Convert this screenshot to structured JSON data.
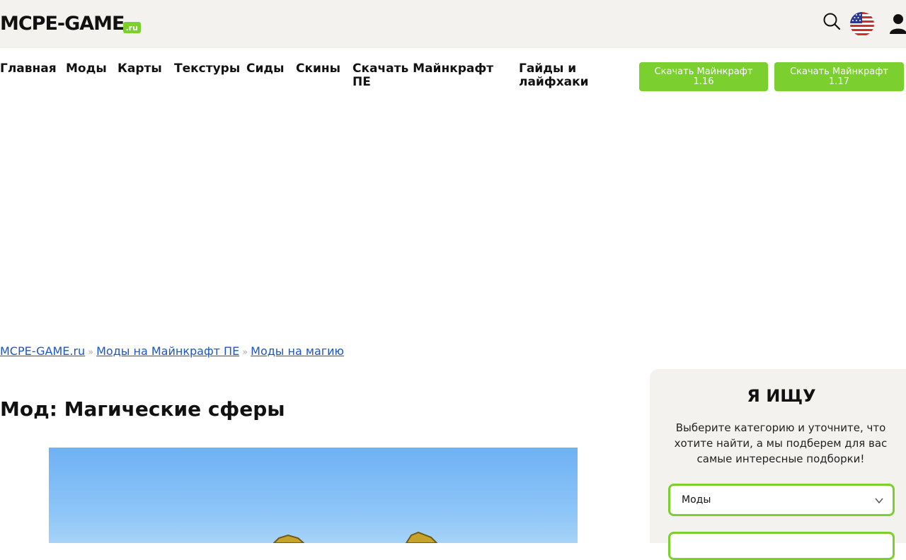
{
  "header": {
    "logo_text": "MCPE-GAME",
    "logo_suffix": ".ru",
    "icons": [
      "search-icon",
      "us-flag-icon",
      "user-icon"
    ]
  },
  "nav": {
    "items": [
      "Главная",
      "Моды",
      "Карты",
      "Текстуры",
      "Сиды",
      "Скины",
      "Скачать Майнкрафт ПЕ",
      "Гайды и лайфхаки"
    ],
    "buttons": [
      {
        "line1": "Скачать Майнкрафт",
        "line2": "1.16"
      },
      {
        "line1": "Скачать Майнкрафт",
        "line2": "1.17"
      }
    ]
  },
  "breadcrumb": {
    "items": [
      "MCPE-GAME.ru",
      "Моды на Майнкрафт ПЕ",
      "Моды на магию"
    ],
    "separator": "»"
  },
  "article": {
    "title": "Мод: Магические сферы"
  },
  "sidebar": {
    "title": "Я ИЩУ",
    "text": "Выберите категорию и уточните, что хотите найти, а мы подберем для вас самые интересные подборки!",
    "select_value": "Моды"
  },
  "colors": {
    "accent": "#7bcf2e",
    "header_bg": "#f3f2ee",
    "link": "#1a56c8"
  }
}
